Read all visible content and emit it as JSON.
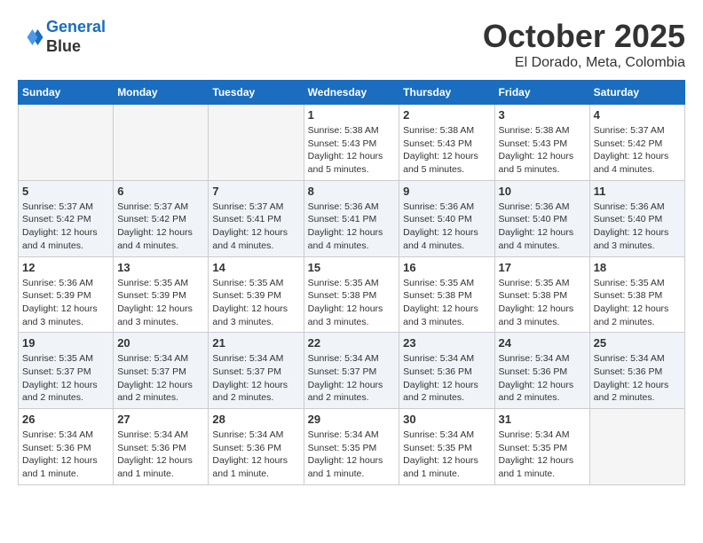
{
  "header": {
    "logo_line1": "General",
    "logo_line2": "Blue",
    "month": "October 2025",
    "location": "El Dorado, Meta, Colombia"
  },
  "weekdays": [
    "Sunday",
    "Monday",
    "Tuesday",
    "Wednesday",
    "Thursday",
    "Friday",
    "Saturday"
  ],
  "weeks": [
    [
      {
        "day": "",
        "sunrise": "",
        "sunset": "",
        "daylight": ""
      },
      {
        "day": "",
        "sunrise": "",
        "sunset": "",
        "daylight": ""
      },
      {
        "day": "",
        "sunrise": "",
        "sunset": "",
        "daylight": ""
      },
      {
        "day": "1",
        "sunrise": "Sunrise: 5:38 AM",
        "sunset": "Sunset: 5:43 PM",
        "daylight": "Daylight: 12 hours and 5 minutes."
      },
      {
        "day": "2",
        "sunrise": "Sunrise: 5:38 AM",
        "sunset": "Sunset: 5:43 PM",
        "daylight": "Daylight: 12 hours and 5 minutes."
      },
      {
        "day": "3",
        "sunrise": "Sunrise: 5:38 AM",
        "sunset": "Sunset: 5:43 PM",
        "daylight": "Daylight: 12 hours and 5 minutes."
      },
      {
        "day": "4",
        "sunrise": "Sunrise: 5:37 AM",
        "sunset": "Sunset: 5:42 PM",
        "daylight": "Daylight: 12 hours and 4 minutes."
      }
    ],
    [
      {
        "day": "5",
        "sunrise": "Sunrise: 5:37 AM",
        "sunset": "Sunset: 5:42 PM",
        "daylight": "Daylight: 12 hours and 4 minutes."
      },
      {
        "day": "6",
        "sunrise": "Sunrise: 5:37 AM",
        "sunset": "Sunset: 5:42 PM",
        "daylight": "Daylight: 12 hours and 4 minutes."
      },
      {
        "day": "7",
        "sunrise": "Sunrise: 5:37 AM",
        "sunset": "Sunset: 5:41 PM",
        "daylight": "Daylight: 12 hours and 4 minutes."
      },
      {
        "day": "8",
        "sunrise": "Sunrise: 5:36 AM",
        "sunset": "Sunset: 5:41 PM",
        "daylight": "Daylight: 12 hours and 4 minutes."
      },
      {
        "day": "9",
        "sunrise": "Sunrise: 5:36 AM",
        "sunset": "Sunset: 5:40 PM",
        "daylight": "Daylight: 12 hours and 4 minutes."
      },
      {
        "day": "10",
        "sunrise": "Sunrise: 5:36 AM",
        "sunset": "Sunset: 5:40 PM",
        "daylight": "Daylight: 12 hours and 4 minutes."
      },
      {
        "day": "11",
        "sunrise": "Sunrise: 5:36 AM",
        "sunset": "Sunset: 5:40 PM",
        "daylight": "Daylight: 12 hours and 3 minutes."
      }
    ],
    [
      {
        "day": "12",
        "sunrise": "Sunrise: 5:36 AM",
        "sunset": "Sunset: 5:39 PM",
        "daylight": "Daylight: 12 hours and 3 minutes."
      },
      {
        "day": "13",
        "sunrise": "Sunrise: 5:35 AM",
        "sunset": "Sunset: 5:39 PM",
        "daylight": "Daylight: 12 hours and 3 minutes."
      },
      {
        "day": "14",
        "sunrise": "Sunrise: 5:35 AM",
        "sunset": "Sunset: 5:39 PM",
        "daylight": "Daylight: 12 hours and 3 minutes."
      },
      {
        "day": "15",
        "sunrise": "Sunrise: 5:35 AM",
        "sunset": "Sunset: 5:38 PM",
        "daylight": "Daylight: 12 hours and 3 minutes."
      },
      {
        "day": "16",
        "sunrise": "Sunrise: 5:35 AM",
        "sunset": "Sunset: 5:38 PM",
        "daylight": "Daylight: 12 hours and 3 minutes."
      },
      {
        "day": "17",
        "sunrise": "Sunrise: 5:35 AM",
        "sunset": "Sunset: 5:38 PM",
        "daylight": "Daylight: 12 hours and 3 minutes."
      },
      {
        "day": "18",
        "sunrise": "Sunrise: 5:35 AM",
        "sunset": "Sunset: 5:38 PM",
        "daylight": "Daylight: 12 hours and 2 minutes."
      }
    ],
    [
      {
        "day": "19",
        "sunrise": "Sunrise: 5:35 AM",
        "sunset": "Sunset: 5:37 PM",
        "daylight": "Daylight: 12 hours and 2 minutes."
      },
      {
        "day": "20",
        "sunrise": "Sunrise: 5:34 AM",
        "sunset": "Sunset: 5:37 PM",
        "daylight": "Daylight: 12 hours and 2 minutes."
      },
      {
        "day": "21",
        "sunrise": "Sunrise: 5:34 AM",
        "sunset": "Sunset: 5:37 PM",
        "daylight": "Daylight: 12 hours and 2 minutes."
      },
      {
        "day": "22",
        "sunrise": "Sunrise: 5:34 AM",
        "sunset": "Sunset: 5:37 PM",
        "daylight": "Daylight: 12 hours and 2 minutes."
      },
      {
        "day": "23",
        "sunrise": "Sunrise: 5:34 AM",
        "sunset": "Sunset: 5:36 PM",
        "daylight": "Daylight: 12 hours and 2 minutes."
      },
      {
        "day": "24",
        "sunrise": "Sunrise: 5:34 AM",
        "sunset": "Sunset: 5:36 PM",
        "daylight": "Daylight: 12 hours and 2 minutes."
      },
      {
        "day": "25",
        "sunrise": "Sunrise: 5:34 AM",
        "sunset": "Sunset: 5:36 PM",
        "daylight": "Daylight: 12 hours and 2 minutes."
      }
    ],
    [
      {
        "day": "26",
        "sunrise": "Sunrise: 5:34 AM",
        "sunset": "Sunset: 5:36 PM",
        "daylight": "Daylight: 12 hours and 1 minute."
      },
      {
        "day": "27",
        "sunrise": "Sunrise: 5:34 AM",
        "sunset": "Sunset: 5:36 PM",
        "daylight": "Daylight: 12 hours and 1 minute."
      },
      {
        "day": "28",
        "sunrise": "Sunrise: 5:34 AM",
        "sunset": "Sunset: 5:36 PM",
        "daylight": "Daylight: 12 hours and 1 minute."
      },
      {
        "day": "29",
        "sunrise": "Sunrise: 5:34 AM",
        "sunset": "Sunset: 5:35 PM",
        "daylight": "Daylight: 12 hours and 1 minute."
      },
      {
        "day": "30",
        "sunrise": "Sunrise: 5:34 AM",
        "sunset": "Sunset: 5:35 PM",
        "daylight": "Daylight: 12 hours and 1 minute."
      },
      {
        "day": "31",
        "sunrise": "Sunrise: 5:34 AM",
        "sunset": "Sunset: 5:35 PM",
        "daylight": "Daylight: 12 hours and 1 minute."
      },
      {
        "day": "",
        "sunrise": "",
        "sunset": "",
        "daylight": ""
      }
    ]
  ]
}
